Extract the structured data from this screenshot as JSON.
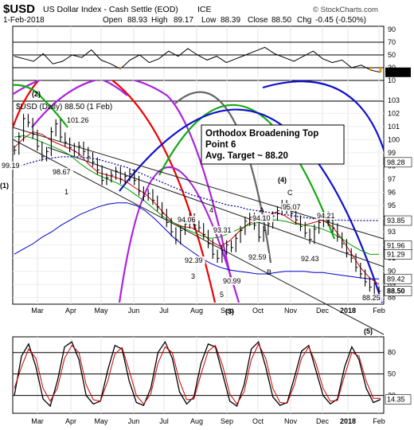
{
  "header": {
    "symbol": "$USD",
    "name": "US Dollar Index - Cash Settle (EOD)",
    "exchange": "ICE",
    "date": "1-Feb-2018",
    "open_label": "Open",
    "open": "88.93",
    "high_label": "High",
    "high": "89.17",
    "low_label": "Low",
    "low": "88.39",
    "close_label": "Close",
    "close": "88.50",
    "chg_label": "Chg",
    "chg": "-0.45 (-0.50%)",
    "watermark": "© StockCharts.com"
  },
  "colors": {
    "price_bar": "#000000",
    "ma_fast": "#cc0000",
    "ma_mid": "#009900",
    "ma_slow": "#0000cc",
    "ma_dotted": "#000099",
    "cycle_red": "#ee0000",
    "cycle_purple": "#aa22dd",
    "cycle_gray": "#666666",
    "cycle_green": "#11aa11",
    "cycle_blue": "#1010cc",
    "wave_label": "#9900cc",
    "rsi_under": "#ff9900",
    "stoch": "#000000",
    "title_blue": "#0000aa"
  },
  "chart_data": [
    {
      "type": "line",
      "panel": "indicator-top",
      "ylim": [
        10,
        95
      ],
      "reference_lines": [
        30,
        50,
        70
      ],
      "ticks": [
        "90",
        "70",
        "50",
        "30",
        "10"
      ],
      "last_value_label": "22.79",
      "x": [
        "Mar",
        "Apr",
        "May",
        "Jun",
        "Jul",
        "Aug",
        "Sep",
        "Oct",
        "Nov",
        "Dec",
        "2018",
        "Feb"
      ],
      "values": [
        48,
        44,
        40,
        52,
        36,
        40,
        50,
        46,
        58,
        42,
        36,
        28,
        42,
        50,
        38,
        44,
        56,
        48,
        60,
        50,
        42,
        48,
        38,
        44,
        50,
        56,
        62,
        52,
        46,
        40,
        48,
        56,
        44,
        38,
        42,
        30,
        34,
        26,
        22.79
      ]
    },
    {
      "type": "line",
      "panel": "price",
      "title": "$USD (Daily) 88.50 (1 Feb)",
      "ylim": [
        87.5,
        104.5
      ],
      "ticks": [
        "103",
        "102",
        "101",
        "100",
        "99",
        "98",
        "97",
        "96",
        "95",
        "94",
        "93",
        "92",
        "91",
        "90",
        "89",
        "88"
      ],
      "x_labels": [
        "Mar",
        "Apr",
        "May",
        "Jun",
        "Jul",
        "Aug",
        "Sep",
        "Oct",
        "Nov",
        "Dec",
        "2018",
        "Feb"
      ],
      "y_value_labels": [
        "98.28",
        "93.85",
        "91.96",
        "91.29",
        "89.42",
        "88.50"
      ],
      "series": [
        {
          "role": "close",
          "values": [
            99.2,
            100.2,
            101.6,
            101.3,
            100.4,
            99.5,
            98.7,
            99.1,
            100.6,
            101.2,
            100.2,
            99.8,
            99.4,
            99.1,
            99.5,
            99.1,
            98.7,
            98.3,
            97.7,
            96.9,
            97.1,
            97.3,
            97.6,
            97.0,
            97.2,
            97.4,
            96.9,
            96.1,
            95.7,
            95.9,
            95.4,
            94.9,
            94.4,
            93.7,
            93.0,
            92.4,
            93.1,
            93.6,
            94.06,
            93.5,
            93.31,
            92.8,
            92.1,
            91.3,
            90.99,
            91.6,
            92.0,
            91.8,
            92.5,
            93.1,
            93.8,
            94.1,
            93.5,
            92.59,
            93.1,
            93.6,
            94.2,
            94.6,
            95.07,
            94.7,
            94.4,
            93.9,
            93.4,
            92.9,
            92.43,
            93.2,
            93.7,
            94.21,
            93.8,
            93.3,
            92.6,
            92.1,
            91.4,
            91.0,
            90.3,
            89.8,
            89.2,
            88.8,
            88.25,
            88.5
          ]
        },
        {
          "role": "ma-fast",
          "values": [
            99.4,
            100.1,
            100.6,
            100.4,
            99.9,
            99.6,
            99.3,
            98.9,
            98.1,
            97.5,
            97.3,
            97.1,
            96.8,
            96.3,
            95.9,
            95.2,
            94.4,
            93.7,
            93.4,
            93.3,
            92.9,
            92.3,
            91.9,
            92.3,
            93.0,
            93.6,
            93.9,
            94.2,
            94.5,
            94.2,
            93.7,
            93.5,
            93.7,
            93.9,
            93.4,
            92.5,
            91.4,
            90.3,
            89.5,
            89.0
          ]
        },
        {
          "role": "ma-mid",
          "values": [
            100.2,
            100.3,
            100.1,
            99.8,
            99.5,
            99.2,
            98.8,
            98.2,
            97.7,
            97.3,
            97.0,
            96.7,
            96.3,
            95.8,
            95.3,
            94.7,
            94.1,
            93.7,
            93.3,
            93.0,
            92.7,
            92.5,
            92.6,
            92.9,
            93.2,
            93.5,
            93.7,
            93.9,
            93.9,
            93.8,
            93.6,
            93.5,
            93.4,
            93.2,
            92.9,
            92.5,
            92.0,
            91.6,
            91.3,
            91.29
          ]
        },
        {
          "role": "ma-slow",
          "values": [
            91.3,
            91.7,
            92.1,
            92.6,
            93.0,
            93.5,
            93.9,
            94.3,
            94.6,
            94.9,
            95.1,
            95.2,
            95.2,
            95.0,
            94.6,
            94.0,
            93.3,
            92.6,
            92.0,
            91.5,
            91.0,
            90.6,
            90.3,
            90.1,
            90.0,
            89.9,
            89.8,
            89.8,
            89.9,
            90.0,
            90.0,
            90.0,
            89.9,
            89.9,
            89.8,
            89.7,
            89.6,
            89.5,
            89.42,
            89.42
          ]
        },
        {
          "role": "ma-dotted",
          "values": [
            97.9,
            98.1,
            98.3,
            98.5,
            98.6,
            98.7,
            98.7,
            98.7,
            98.6,
            98.5,
            98.3,
            98.1,
            97.9,
            97.6,
            97.3,
            97.0,
            96.7,
            96.4,
            96.1,
            95.8,
            95.6,
            95.4,
            95.2,
            95.0,
            94.9,
            94.7,
            94.6,
            94.5,
            94.4,
            94.3,
            94.2,
            94.1,
            94.0,
            93.95,
            93.9,
            93.88,
            93.86,
            93.85,
            93.85,
            93.85
          ]
        }
      ]
    },
    {
      "type": "line",
      "panel": "stochastic",
      "ylim": [
        -5,
        102
      ],
      "reference_lines": [
        20,
        50,
        80
      ],
      "ticks": [
        "80",
        "50",
        "20"
      ],
      "last_value_label": "14.35",
      "x_labels": [
        "Mar",
        "Apr",
        "May",
        "Jun",
        "Jul",
        "Aug",
        "Sep",
        "Oct",
        "Nov",
        "Dec",
        "2018",
        "Feb"
      ],
      "series": [
        {
          "name": "%K",
          "values": [
            20,
            75,
            92,
            60,
            15,
            5,
            40,
            88,
            95,
            70,
            20,
            8,
            12,
            55,
            90,
            85,
            40,
            10,
            6,
            30,
            80,
            95,
            72,
            25,
            8,
            18,
            65,
            92,
            88,
            50,
            12,
            5,
            35,
            85,
            95,
            60,
            18,
            6,
            10,
            45,
            82,
            90,
            55,
            20,
            8,
            15,
            60,
            88,
            70,
            30,
            10,
            14.35
          ]
        },
        {
          "name": "%D",
          "values": [
            30,
            60,
            85,
            72,
            30,
            12,
            30,
            72,
            90,
            80,
            35,
            14,
            12,
            40,
            78,
            87,
            55,
            20,
            8,
            22,
            65,
            88,
            80,
            40,
            14,
            15,
            50,
            82,
            90,
            62,
            22,
            8,
            25,
            70,
            92,
            72,
            30,
            10,
            9,
            35,
            72,
            88,
            65,
            30,
            12,
            13,
            48,
            80,
            75,
            40,
            16,
            16
          ]
        }
      ]
    }
  ],
  "annotations": {
    "callout": [
      "Orthodox Broadening Top",
      "Point 6",
      "Avg. Target ~ 88.20"
    ],
    "price_labels": [
      "99.19",
      "98.67",
      "101.26",
      "92.39",
      "94.06",
      "93.31",
      "90.99",
      "94.10",
      "92.59",
      "95.07",
      "92.43",
      "94.21",
      "88.25"
    ],
    "wave_black": [
      "(1)",
      "(2)",
      "(3)",
      "(4)",
      "(5)"
    ],
    "wave_purple": [
      "1",
      "3",
      "4",
      "5",
      "A",
      "B",
      "C"
    ]
  }
}
